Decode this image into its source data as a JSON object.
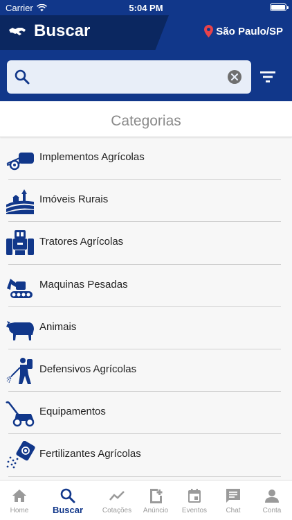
{
  "status_bar": {
    "carrier": "Carrier",
    "time": "5:04 PM"
  },
  "header": {
    "title": "Buscar",
    "location": "São Paulo/SP"
  },
  "search": {
    "value": "",
    "placeholder": ""
  },
  "section": {
    "title": "Categorias"
  },
  "categories": [
    {
      "label": "Implementos Agrícolas",
      "icon": "baler-icon"
    },
    {
      "label": "Imóveis Rurais",
      "icon": "rural-property-icon"
    },
    {
      "label": "Tratores Agrícolas",
      "icon": "tractor-icon"
    },
    {
      "label": "Maquinas Pesadas",
      "icon": "excavator-icon"
    },
    {
      "label": "Animais",
      "icon": "cow-icon"
    },
    {
      "label": "Defensivos Agrícolas",
      "icon": "sprayer-person-icon"
    },
    {
      "label": "Equipamentos",
      "icon": "lawn-mower-icon"
    },
    {
      "label": "Fertilizantes Agrícolas",
      "icon": "fertilizer-bag-icon"
    }
  ],
  "tabs": [
    {
      "label": "Home",
      "icon": "home-icon"
    },
    {
      "label": "Buscar",
      "icon": "search-icon"
    },
    {
      "label": "Cotações",
      "icon": "trend-icon"
    },
    {
      "label": "Anúncio",
      "icon": "add-document-icon"
    },
    {
      "label": "Eventos",
      "icon": "calendar-icon"
    },
    {
      "label": "Chat",
      "icon": "chat-icon"
    },
    {
      "label": "Conta",
      "icon": "person-icon"
    }
  ],
  "colors": {
    "brand": "#11378a",
    "brand_dark": "#0b2760",
    "pin": "#e8424a",
    "inactive": "#9a9a9a"
  }
}
